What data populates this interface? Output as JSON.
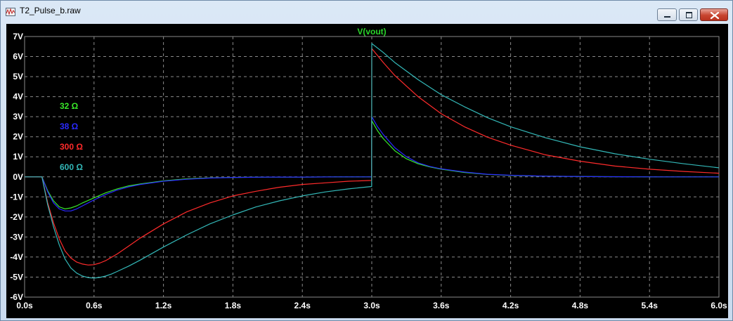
{
  "window": {
    "title": "T2_Pulse_b.raw",
    "icons": {
      "app": "waveform-icon",
      "minimize": "minimize-icon",
      "maximize": "maximize-icon",
      "close": "close-icon"
    }
  },
  "colors": {
    "background": "#000000",
    "grid": "#8a8a8a",
    "axis_text": "#ffffff",
    "title": "#2bd62b"
  },
  "chart_data": {
    "type": "line",
    "title": "V(vout)",
    "xlabel": "",
    "ylabel": "",
    "xlim": [
      0,
      6.0
    ],
    "ylim": [
      -6,
      7
    ],
    "x_ticks": [
      0,
      0.6,
      1.2,
      1.8,
      2.4,
      3.0,
      3.6,
      4.2,
      4.8,
      5.4,
      6.0
    ],
    "x_tick_labels": [
      "0.0s",
      "0.6s",
      "1.2s",
      "1.8s",
      "2.4s",
      "3.0s",
      "3.6s",
      "4.2s",
      "4.8s",
      "5.4s",
      "6.0s"
    ],
    "y_ticks": [
      7,
      6,
      5,
      4,
      3,
      2,
      1,
      0,
      -1,
      -2,
      -3,
      -4,
      -5,
      -6
    ],
    "y_tick_labels": [
      "7V",
      "6V",
      "5V",
      "4V",
      "3V",
      "2V",
      "1V",
      "0V",
      "-1V",
      "-2V",
      "-3V",
      "-4V",
      "-5V",
      "-6V"
    ],
    "grid": true,
    "legend": "left",
    "series": [
      {
        "name": "32 Ω",
        "color": "#39e82a",
        "x": [
          0,
          0.15,
          0.2,
          0.25,
          0.3,
          0.35,
          0.4,
          0.45,
          0.5,
          0.6,
          0.7,
          0.8,
          0.9,
          1.0,
          1.2,
          1.4,
          1.6,
          1.8,
          2.1,
          2.4,
          2.7,
          2.999,
          3.0,
          3.05,
          3.1,
          3.2,
          3.3,
          3.4,
          3.5,
          3.6,
          3.8,
          4.0,
          4.2,
          4.5,
          5.0,
          5.5,
          6.0
        ],
        "values": [
          0,
          0,
          -0.7,
          -1.2,
          -1.5,
          -1.6,
          -1.55,
          -1.45,
          -1.3,
          -1.05,
          -0.8,
          -0.6,
          -0.45,
          -0.35,
          -0.2,
          -0.1,
          -0.05,
          -0.03,
          -0.01,
          -0.01,
          0,
          0,
          2.8,
          2.3,
          1.9,
          1.3,
          0.9,
          0.65,
          0.5,
          0.38,
          0.22,
          0.12,
          0.07,
          0.03,
          0.01,
          0,
          0
        ]
      },
      {
        "name": "38 Ω",
        "color": "#2a2aff",
        "x": [
          0,
          0.15,
          0.2,
          0.25,
          0.3,
          0.35,
          0.4,
          0.45,
          0.5,
          0.6,
          0.7,
          0.8,
          0.9,
          1.0,
          1.2,
          1.4,
          1.6,
          1.8,
          2.1,
          2.4,
          2.7,
          2.999,
          3.0,
          3.05,
          3.1,
          3.2,
          3.3,
          3.4,
          3.5,
          3.6,
          3.8,
          4.0,
          4.2,
          4.5,
          5.0,
          5.5,
          6.0
        ],
        "values": [
          0,
          0,
          -0.75,
          -1.3,
          -1.6,
          -1.7,
          -1.7,
          -1.6,
          -1.45,
          -1.15,
          -0.88,
          -0.66,
          -0.5,
          -0.38,
          -0.22,
          -0.12,
          -0.06,
          -0.03,
          -0.01,
          -0.01,
          0,
          0,
          3.0,
          2.5,
          2.1,
          1.45,
          1.0,
          0.7,
          0.52,
          0.4,
          0.24,
          0.13,
          0.08,
          0.03,
          0.01,
          0,
          0
        ]
      },
      {
        "name": "300 Ω",
        "color": "#ff2b2b",
        "x": [
          0,
          0.15,
          0.2,
          0.25,
          0.3,
          0.35,
          0.4,
          0.45,
          0.5,
          0.55,
          0.6,
          0.65,
          0.7,
          0.8,
          0.9,
          1.0,
          1.2,
          1.4,
          1.6,
          1.8,
          2.0,
          2.2,
          2.4,
          2.6,
          2.8,
          2.999,
          3.0,
          3.1,
          3.2,
          3.4,
          3.6,
          3.8,
          4.0,
          4.2,
          4.5,
          4.8,
          5.1,
          5.4,
          5.7,
          6.0
        ],
        "values": [
          0,
          0,
          -1.3,
          -2.3,
          -3.1,
          -3.7,
          -4.05,
          -4.25,
          -4.35,
          -4.4,
          -4.38,
          -4.3,
          -4.18,
          -3.85,
          -3.45,
          -3.05,
          -2.35,
          -1.75,
          -1.3,
          -0.95,
          -0.72,
          -0.52,
          -0.38,
          -0.3,
          -0.22,
          -0.18,
          6.4,
          5.7,
          5.05,
          4.0,
          3.15,
          2.5,
          1.98,
          1.58,
          1.1,
          0.78,
          0.54,
          0.38,
          0.27,
          0.18
        ]
      },
      {
        "name": "600 Ω",
        "color": "#33b8b8",
        "x": [
          0,
          0.15,
          0.2,
          0.25,
          0.3,
          0.35,
          0.4,
          0.45,
          0.5,
          0.55,
          0.6,
          0.65,
          0.7,
          0.75,
          0.8,
          0.9,
          1.0,
          1.2,
          1.4,
          1.6,
          1.8,
          2.0,
          2.2,
          2.4,
          2.6,
          2.8,
          2.999,
          3.0,
          3.1,
          3.2,
          3.4,
          3.6,
          3.8,
          4.0,
          4.2,
          4.5,
          4.8,
          5.1,
          5.4,
          5.7,
          6.0
        ],
        "values": [
          0,
          0,
          -1.4,
          -2.5,
          -3.4,
          -4.1,
          -4.55,
          -4.8,
          -4.95,
          -5.03,
          -5.05,
          -5.02,
          -4.95,
          -4.85,
          -4.72,
          -4.45,
          -4.15,
          -3.5,
          -2.9,
          -2.35,
          -1.9,
          -1.5,
          -1.2,
          -0.95,
          -0.75,
          -0.6,
          -0.48,
          6.65,
          6.2,
          5.7,
          4.85,
          4.1,
          3.5,
          2.95,
          2.5,
          1.95,
          1.5,
          1.15,
          0.88,
          0.65,
          0.45
        ]
      }
    ]
  }
}
